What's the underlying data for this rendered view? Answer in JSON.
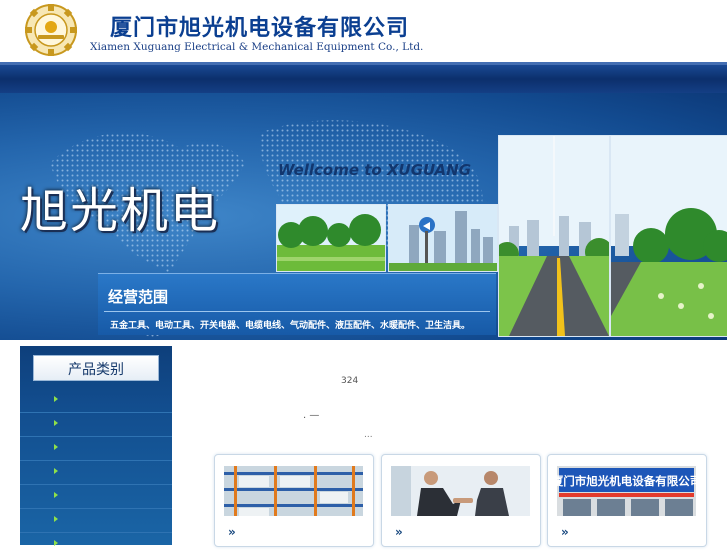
{
  "header": {
    "company_name_cn": "厦门市旭光机电设备有限公司",
    "company_name_en": "Xiamen Xuguang Electrical & Mechanical Equipment Co., Ltd.",
    "logo_icon": "gear-logo-icon"
  },
  "banner": {
    "title": "旭光机电",
    "welcome": "Wellcome to XUGUANG",
    "scope_title": "经营范围",
    "scope_text": "五金工具、电动工具、开关电器、电缆电线、气动配件、液压配件、水暖配件、卫生洁具。"
  },
  "sidebar": {
    "title": "产品类别",
    "items": [
      "",
      "",
      "",
      "",
      "",
      "",
      ""
    ]
  },
  "content": {
    "count_text": "324",
    "dash_text": ". —",
    "ellipsis_text": "..."
  },
  "cards": [
    {
      "more_label": "»",
      "image": "warehouse-shelves-image"
    },
    {
      "more_label": "»",
      "image": "business-handshake-image"
    },
    {
      "more_label": "»",
      "image": "storefront-sign-image",
      "sign_text": "厦门市旭光机电设备有限公司"
    }
  ],
  "colors": {
    "brand_blue": "#0b3f91",
    "nav_blue": "#0c2f6c",
    "banner_blue": "#2466ad",
    "sidebar_blue": "#124d8e",
    "bullet_green": "#8ee04a"
  }
}
